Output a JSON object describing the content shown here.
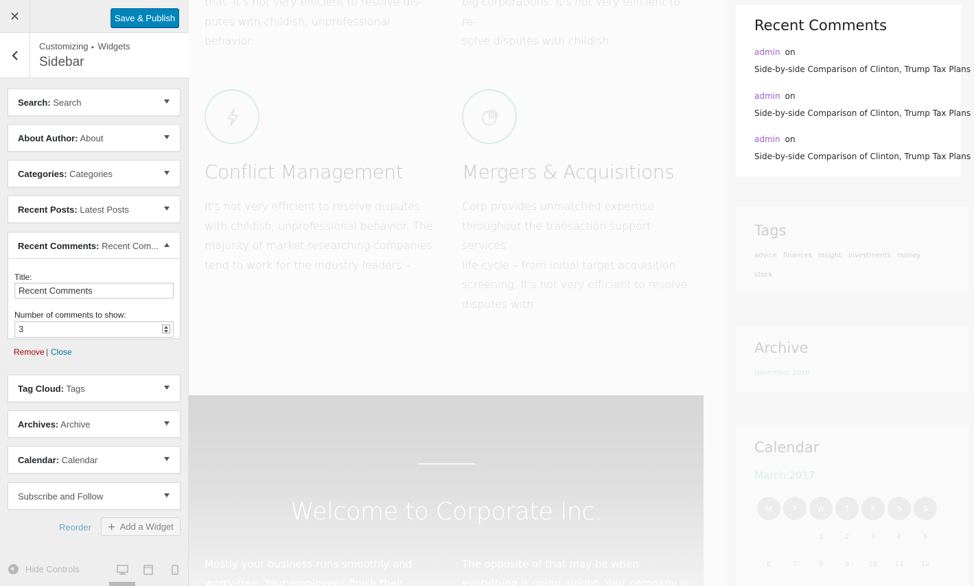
{
  "customizer": {
    "close_glyph": "✕",
    "save_label": "Save & Publish",
    "breadcrumb": {
      "root": "Customizing",
      "separator": "▸",
      "current": "Widgets"
    },
    "section_title": "Sidebar",
    "widgets": [
      {
        "type": "Search:",
        "title": "Search"
      },
      {
        "type": "About Author:",
        "title": "About"
      },
      {
        "type": "Categories:",
        "title": "Categories"
      },
      {
        "type": "Recent Posts:",
        "title": "Latest Posts"
      },
      {
        "type": "Recent Comments:",
        "title": "Recent Com..."
      },
      {
        "type": "Tag Cloud:",
        "title": "Tags"
      },
      {
        "type": "Archives:",
        "title": "Archive"
      },
      {
        "type": "Calendar:",
        "title": "Calendar"
      },
      {
        "type": "Subscribe and Follow",
        "title": ""
      }
    ],
    "open_widget": {
      "title_label": "Title:",
      "title_value": "Recent Comments",
      "number_label": "Number of comments to show:",
      "number_value": "3",
      "remove_label": "Remove",
      "separator": "|",
      "close_label": "Close"
    },
    "reorder_label": "Reorder",
    "add_widget_label": "Add a Widget",
    "hide_controls_label": "Hide Controls"
  },
  "preview": {
    "top_left_text": [
      "that. It's not very efficient to resolve dis-",
      "putes with childish, unprofessional behavior."
    ],
    "top_right_text": [
      "big corporations. It's not very efficient to re-",
      "solve disputes with childish."
    ],
    "services": [
      {
        "title": "Conflict Management",
        "text": [
          "It's not very efficient to resolve disputes",
          "with childish, unprofessional behavior. The",
          "majority of market researching companies",
          "tend to work for the industry leaders –"
        ]
      },
      {
        "title": "Mergers & Acquisitions",
        "text": [
          "Corp provides unmatched expertise",
          "throughout the transaction support services",
          "life cycle – from initial target acquisition",
          "screening. It's not very efficient to resolve",
          "disputes with"
        ]
      }
    ],
    "hero": {
      "title": "Welcome to Corporate Inc.",
      "left_text": "Mostly your business runs smoothly and worry-free. Your employees finish their tasks",
      "right_text": "The opposite of that may be when everything is going alright. Your company is growing"
    },
    "sidebar": {
      "recent_comments": {
        "title": "Recent Comments",
        "items": [
          {
            "author": "admin",
            "on": "on",
            "post": "Side-by-side Comparison of Clinton, Trump Tax Plans"
          },
          {
            "author": "admin",
            "on": "on",
            "post": "Side-by-side Comparison of Clinton, Trump Tax Plans"
          },
          {
            "author": "admin",
            "on": "on",
            "post": "Side-by-side Comparison of Clinton, Trump Tax Plans"
          }
        ]
      },
      "tags": {
        "title": "Tags",
        "items": [
          "advice",
          "finances",
          "insight",
          "investments",
          "money",
          "stock"
        ]
      },
      "archive": {
        "title": "Archive",
        "items": [
          "November 2016"
        ]
      },
      "calendar": {
        "title": "Calendar",
        "month": "March 2017",
        "days": [
          "M",
          "T",
          "W",
          "T",
          "F",
          "S",
          "S"
        ],
        "row1": [
          "1",
          "2",
          "3",
          "4",
          "5"
        ],
        "row2": [
          "6",
          "7",
          "8",
          "9",
          "10",
          "11",
          "12"
        ]
      }
    }
  },
  "colors": {
    "accent": "#0085ba",
    "link": "#0073aa",
    "danger": "#a00",
    "author": "#a05bd6",
    "teal": "#1fbf9a"
  },
  "icons": [
    "close-icon",
    "back-chevron-icon",
    "dropdown-arrow-icon",
    "plus-icon",
    "hide-controls-icon",
    "desktop-icon",
    "tablet-icon",
    "mobile-icon",
    "lightning-icon",
    "pie-chart-icon"
  ]
}
